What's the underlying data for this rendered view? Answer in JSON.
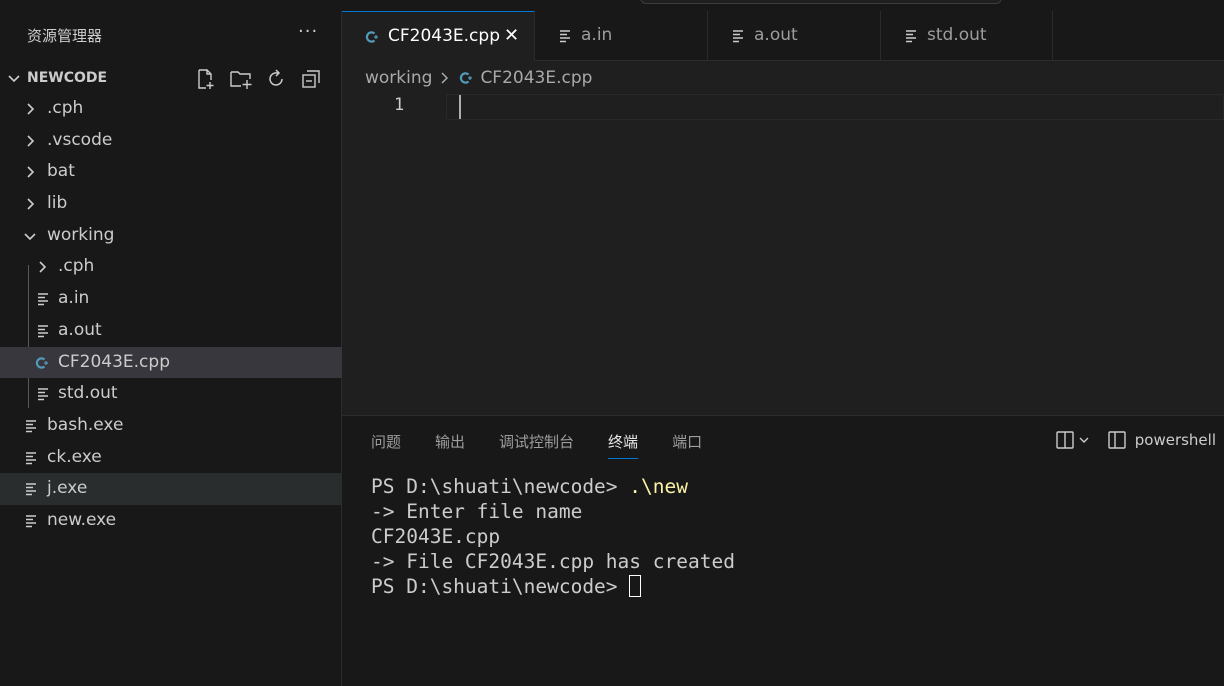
{
  "sidebar": {
    "title": "资源管理器",
    "more_label": "···",
    "section_name": "NEWCODE",
    "actions": [
      "new-file-icon",
      "new-folder-icon",
      "refresh-icon",
      "collapse-all-icon"
    ],
    "items": [
      {
        "label": ".cph",
        "type": "folder",
        "expanded": false,
        "depth": 0
      },
      {
        "label": ".vscode",
        "type": "folder",
        "expanded": false,
        "depth": 0
      },
      {
        "label": "bat",
        "type": "folder",
        "expanded": false,
        "depth": 0
      },
      {
        "label": "lib",
        "type": "folder",
        "expanded": false,
        "depth": 0
      },
      {
        "label": "working",
        "type": "folder",
        "expanded": true,
        "depth": 0
      },
      {
        "label": ".cph",
        "type": "folder",
        "expanded": false,
        "depth": 1
      },
      {
        "label": "a.in",
        "type": "file",
        "depth": 1
      },
      {
        "label": "a.out",
        "type": "file",
        "depth": 1
      },
      {
        "label": "CF2043E.cpp",
        "type": "cpp",
        "depth": 1,
        "selected": true
      },
      {
        "label": "std.out",
        "type": "file",
        "depth": 1
      },
      {
        "label": "bash.exe",
        "type": "file",
        "depth": 0
      },
      {
        "label": "ck.exe",
        "type": "file",
        "depth": 0
      },
      {
        "label": "j.exe",
        "type": "file",
        "depth": 0,
        "hover": true
      },
      {
        "label": "new.exe",
        "type": "file",
        "depth": 0
      }
    ]
  },
  "editor": {
    "tabs": [
      {
        "label": "CF2043E.cpp",
        "type": "cpp",
        "active": true,
        "close": "✕"
      },
      {
        "label": "a.in",
        "type": "file"
      },
      {
        "label": "a.out",
        "type": "file"
      },
      {
        "label": "std.out",
        "type": "file"
      }
    ],
    "breadcrumb": {
      "folder": "working",
      "file": "CF2043E.cpp"
    },
    "line_number": "1"
  },
  "panel": {
    "tabs": [
      "问题",
      "输出",
      "调试控制台",
      "终端",
      "端口"
    ],
    "active_tab": "终端",
    "terminal_name": "powershell",
    "terminal": {
      "line1_prompt": "PS D:\\shuati\\newcode> ",
      "line1_cmd": ".\\new",
      "line2": "-> Enter file name",
      "line3": "CF2043E.cpp",
      "line4": "-> File CF2043E.cpp has created",
      "line5_prompt": "PS D:\\shuati\\newcode> "
    }
  },
  "colors": {
    "background": "#181818",
    "editor_bg": "#1f1f1f",
    "accent": "#0078d4",
    "cpp_icon": "#519aba",
    "command_yellow": "#f9f1a5"
  }
}
